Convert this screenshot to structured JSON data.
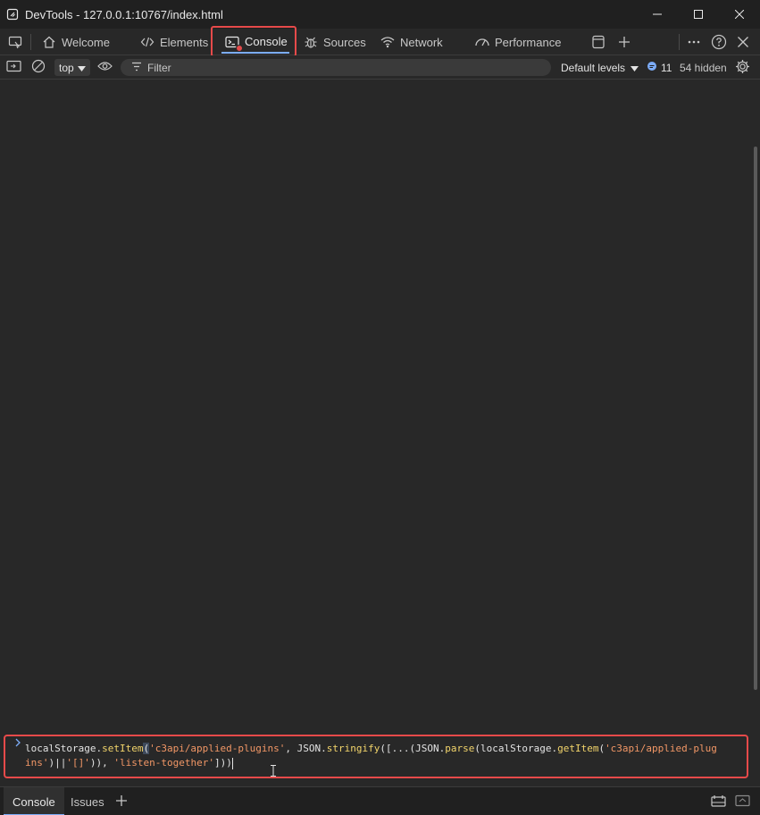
{
  "window": {
    "title": "DevTools - 127.0.0.1:10767/index.html"
  },
  "tabs": [
    {
      "label": "Welcome",
      "icon": "home-icon"
    },
    {
      "label": "Elements",
      "icon": "code-icon"
    },
    {
      "label": "Console",
      "icon": "console-icon",
      "active": true
    },
    {
      "label": "Sources",
      "icon": "bug-icon"
    },
    {
      "label": "Network",
      "icon": "wifi-icon"
    },
    {
      "label": "Performance",
      "icon": "gauge-icon"
    }
  ],
  "toolbar": {
    "context": "top",
    "filter_placeholder": "Filter",
    "levels": "Default levels",
    "message_count": "11",
    "hidden_count": "54 hidden"
  },
  "console": {
    "prompt_code": {
      "l1": "localStorage.",
      "fn1": "setItem",
      "p1": "(",
      "s1": "'c3api/applied-plugins'",
      "p2": ", JSON.",
      "fn2": "stringify",
      "p3": "([...(JSON.",
      "fn3": "parse",
      "p4": "(localStorage.",
      "fn4": "getItem",
      "p5": "(",
      "s2": "'c3api/applied-plugins'",
      "p6": ")||",
      "s3": "'[]'",
      "p7": ")), ",
      "s4": "'listen-together'",
      "p8": "]))"
    }
  },
  "drawer": {
    "tabs": [
      {
        "label": "Console",
        "active": true
      },
      {
        "label": "Issues"
      }
    ]
  },
  "colors": {
    "accent": "#7cacf8",
    "highlight_box": "#e64a4a",
    "background": "#282828"
  }
}
